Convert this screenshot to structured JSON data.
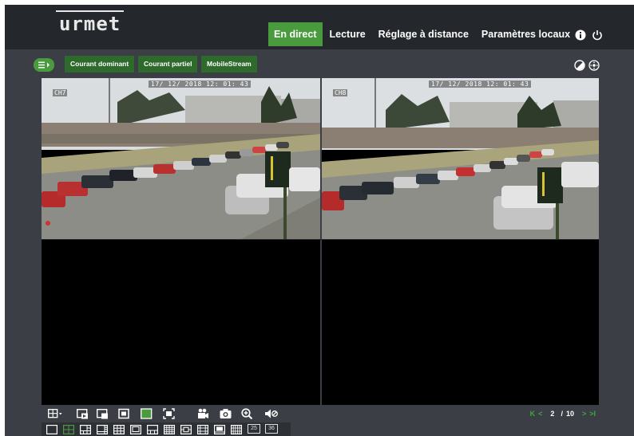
{
  "header": {
    "logo": "urmet",
    "nav": [
      {
        "label": "En direct",
        "active": true
      },
      {
        "label": "Lecture",
        "active": false
      },
      {
        "label": "Réglage à distance",
        "active": false
      },
      {
        "label": "Paramètres locaux",
        "active": false
      }
    ],
    "icons": [
      "info-icon",
      "power-icon"
    ]
  },
  "toolbar": {
    "menu_icon": "list-menu-icon",
    "streams": [
      "Courant dominant",
      "Courant partiel",
      "MobileStream"
    ],
    "right_icons": [
      "color-adjust-icon",
      "ptz-control-icon"
    ]
  },
  "cameras": [
    {
      "label": "CH7",
      "timestamp": "17/ 12/ 2018  12: 01: 43"
    },
    {
      "label": "CH8",
      "timestamp": "17/ 12/ 2018  12: 01: 43"
    }
  ],
  "bottom": {
    "controls": [
      "split-screen-icon",
      "previous-group-icon",
      "next-group-icon",
      "single-view-icon",
      "active-view-icon",
      "fullscreen-icon",
      "record-icon",
      "snapshot-icon",
      "zoom-icon",
      "audio-icon"
    ],
    "pager": {
      "first": "K",
      "prev": "<",
      "current": "2",
      "separator": "/",
      "total": "10",
      "next": ">",
      "last": ">I"
    }
  },
  "layouts": [
    "1",
    "4",
    "6",
    "8",
    "9",
    "10",
    "13",
    "16",
    "17",
    "20",
    "22",
    "24",
    "25",
    "36"
  ],
  "colors": {
    "accent_green": "#4a9b3e",
    "dark_green": "#2e6a2c",
    "header_bg": "#24272c",
    "panel_bg": "#3b3e44"
  }
}
